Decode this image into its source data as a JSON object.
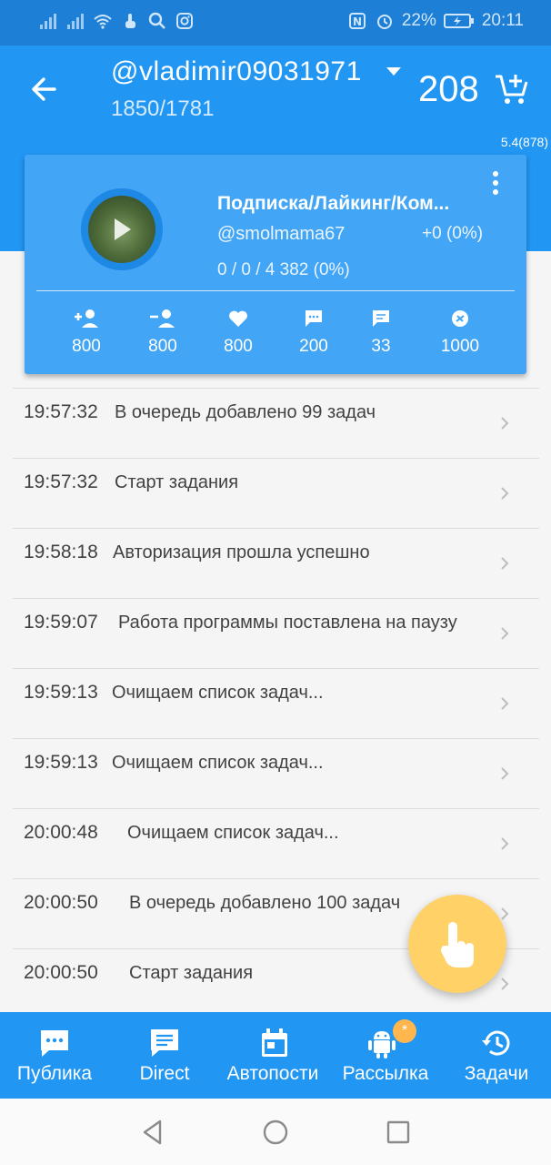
{
  "status_bar": {
    "battery_percent": "22%",
    "time": "20:11",
    "icons": [
      "signal-icon",
      "signal-icon",
      "wifi-icon",
      "touch-icon",
      "search-icon",
      "instagram-icon",
      "nfc-icon",
      "alarm-icon",
      "battery-charging-icon"
    ]
  },
  "app_bar": {
    "account": "@vladimir09031971",
    "counts": "1850/1781",
    "balance": "208",
    "version": "5.4(878)"
  },
  "task_card": {
    "title": "Подписка/Лайкинг/Ком...",
    "target": "@smolmama67",
    "delta": "+0 (0%)",
    "progress": "0 / 0 / 4 382 (0%)",
    "stats": [
      {
        "icon": "add-user-icon",
        "value": "800"
      },
      {
        "icon": "remove-user-icon",
        "value": "800"
      },
      {
        "icon": "heart-icon",
        "value": "800"
      },
      {
        "icon": "comment-icon",
        "value": "200"
      },
      {
        "icon": "message-icon",
        "value": "33"
      },
      {
        "icon": "stories-icon",
        "value": "1000"
      }
    ]
  },
  "log": [
    {
      "time": "19:57:32",
      "text": "В очередь добавлено 99 задач"
    },
    {
      "time": "19:57:32",
      "text": "Старт задания"
    },
    {
      "time": "19:58:18",
      "text": "Авторизация прошла успешно"
    },
    {
      "time": "19:59:07",
      "text": "Работа программы поставлена на паузу"
    },
    {
      "time": "19:59:13",
      "text": "Очищаем список задач..."
    },
    {
      "time": "19:59:13",
      "text": "Очищаем список задач..."
    },
    {
      "time": "20:00:48",
      "text": "Очищаем список задач..."
    },
    {
      "time": "20:00:50",
      "text": "В очередь добавлено 100 задач"
    },
    {
      "time": "20:00:50",
      "text": "Старт задания"
    }
  ],
  "bottom_nav": {
    "items": [
      {
        "label": "Публика",
        "icon": "chat-dots-icon"
      },
      {
        "label": "Direct",
        "icon": "message-icon"
      },
      {
        "label": "Автопости",
        "icon": "calendar-icon"
      },
      {
        "label": "Рассылка",
        "icon": "android-icon",
        "badge": "*"
      },
      {
        "label": "Задачи",
        "icon": "history-icon"
      }
    ]
  },
  "colors": {
    "primary": "#2196f3",
    "status_bar": "#1e7fd6",
    "card": "#42a5f5",
    "fab": "#ffd166"
  }
}
